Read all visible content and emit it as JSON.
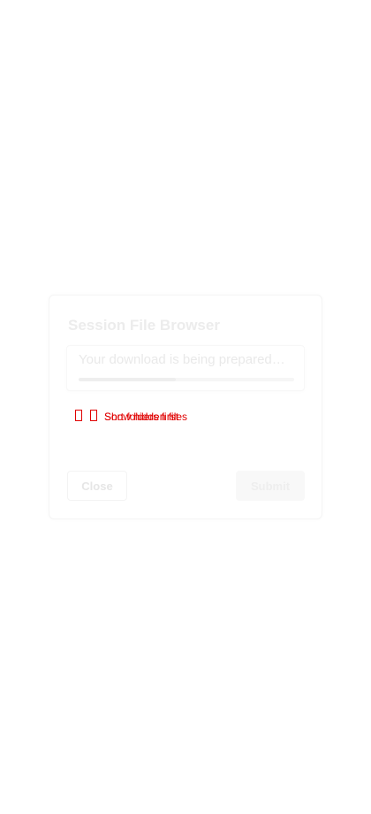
{
  "dialog": {
    "title": "Session File Browser",
    "status_text": "Your download is being prepared…",
    "progress": 0.45,
    "toggles": {
      "show_hidden_label": "Show hidden files",
      "sort_label": "Sort folders first"
    },
    "buttons": {
      "close": "Close",
      "submit": "Submit"
    }
  },
  "colors": {
    "checkbox_accent": "#e00000",
    "faded_text": "#ececec"
  }
}
